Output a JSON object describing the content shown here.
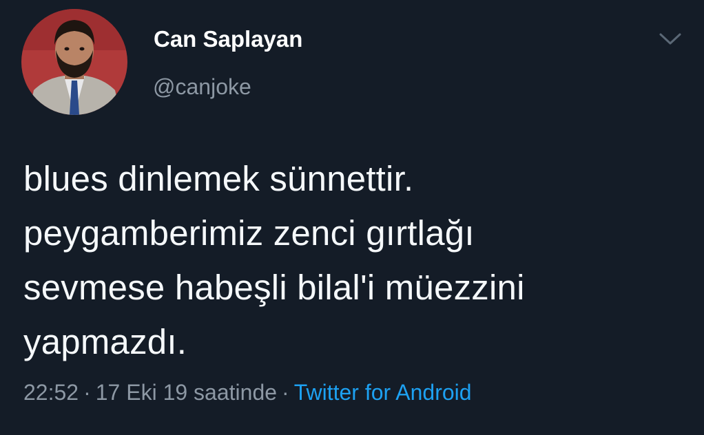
{
  "colors": {
    "background": "#141c27",
    "primary_text": "#ffffff",
    "secondary_text": "#8d98a4",
    "accent": "#1da1f2"
  },
  "author": {
    "display_name": "Can Saplayan",
    "handle": "@canjoke",
    "avatar": "profile-photo"
  },
  "menu_icon": "chevron-down-icon",
  "tweet": {
    "lines": [
      "blues dinlemek sünnettir.",
      "peygamberimiz zenci gırtlağı",
      "sevmese habeşli bilal'i müezzini",
      "yapmazdı."
    ]
  },
  "meta": {
    "time": "22:52",
    "separator": "·",
    "date": "17 Eki 19 saatinde",
    "source": "Twitter for Android"
  }
}
